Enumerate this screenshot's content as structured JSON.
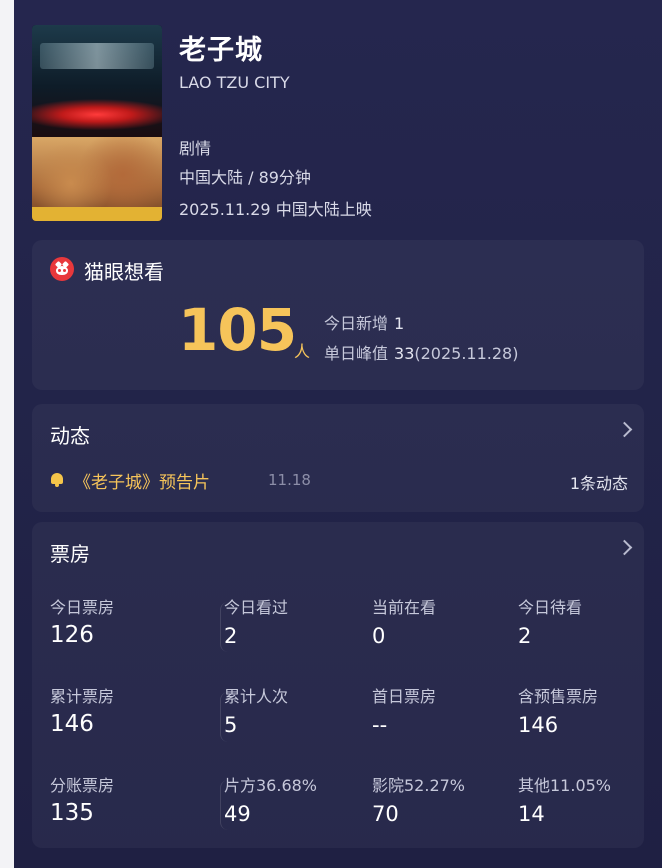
{
  "movie": {
    "title": "老子城",
    "title_en": "LAO TZU CITY",
    "genre": "剧情",
    "region_runtime": "中国大陆 / 89分钟",
    "release": "2025.11.29 中国大陆上映"
  },
  "want": {
    "title": "猫眼想看",
    "count": "105",
    "unit": "人",
    "today_new_label": "今日新增",
    "today_new_value": "1",
    "peak_label": "单日峰值",
    "peak_value": "33",
    "peak_date": "(2025.11.28)"
  },
  "news": {
    "title": "动态",
    "item_text": "《老子城》预告片",
    "item_date": "11.18",
    "count_text": "1条动态"
  },
  "boxoffice": {
    "title": "票房",
    "rows": [
      [
        {
          "label": "今日票房",
          "value": "126"
        },
        {
          "label": "今日看过",
          "value": "2"
        },
        {
          "label": "当前在看",
          "value": "0"
        },
        {
          "label": "今日待看",
          "value": "2"
        }
      ],
      [
        {
          "label": "累计票房",
          "value": "146"
        },
        {
          "label": "累计人次",
          "value": "5"
        },
        {
          "label": "首日票房",
          "value": "--"
        },
        {
          "label": "含预售票房",
          "value": "146"
        }
      ],
      [
        {
          "label": "分账票房",
          "value": "135"
        },
        {
          "label": "片方36.68%",
          "value": "49"
        },
        {
          "label": "影院52.27%",
          "value": "70"
        },
        {
          "label": "其他11.05%",
          "value": "14"
        }
      ]
    ]
  },
  "colors": {
    "accent_gold": "#f6c45a",
    "background": "#232449",
    "cat_red": "#e8383c"
  }
}
